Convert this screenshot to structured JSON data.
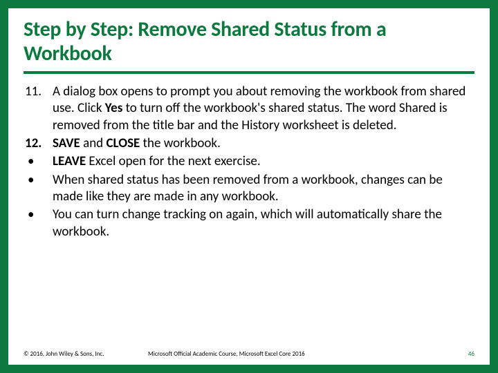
{
  "title": "Step by Step: Remove Shared Status from a Workbook",
  "items": [
    {
      "marker": "11.",
      "html": "A dialog box opens to prompt you about removing the workbook from shared use. Click <b>Yes</b> to turn off the workbook's shared status. The word Shared is removed from the title bar and the History worksheet is deleted."
    },
    {
      "marker": "12.",
      "html": "<b>SAVE</b> and <b>CLOSE</b> the workbook."
    },
    {
      "marker": "•",
      "html": "<b>LEAVE</b> Excel open for the next exercise."
    },
    {
      "marker": "•",
      "html": "When shared status has been removed from a workbook, changes can be made like they are made in any workbook."
    },
    {
      "marker": "•",
      "html": "You can turn change tracking on again, which will automatically share the workbook."
    }
  ],
  "footer": {
    "copyright": "© 2016, John Wiley & Sons, Inc.",
    "course": "Microsoft Official Academic Course, Microsoft Excel Core 2016",
    "page": "46"
  }
}
